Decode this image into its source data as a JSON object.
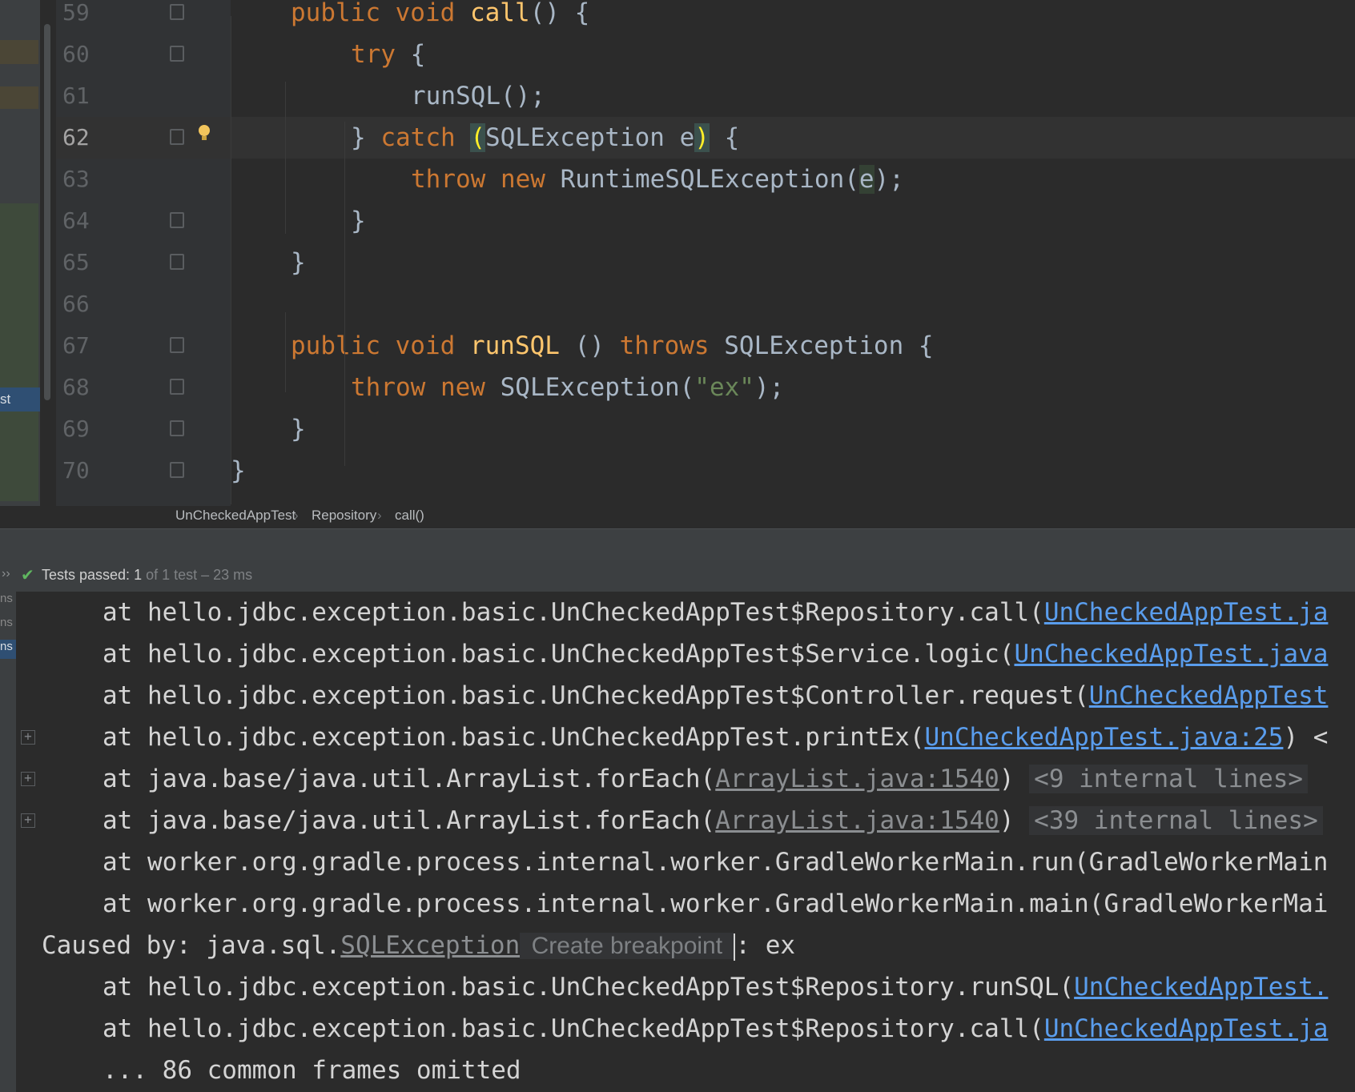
{
  "editor": {
    "side_tab_label": "st",
    "lines": [
      {
        "num": "59",
        "code": [
          {
            "t": "public void ",
            "c": "kw"
          },
          {
            "t": "call",
            "c": "fn"
          },
          {
            "t": "() {",
            "c": ""
          }
        ],
        "indent": 1
      },
      {
        "num": "60",
        "code": [
          {
            "t": "try ",
            "c": "kw"
          },
          {
            "t": "{",
            "c": ""
          }
        ],
        "indent": 2
      },
      {
        "num": "61",
        "code": [
          {
            "t": "runSQL();",
            "c": ""
          }
        ],
        "indent": 3
      },
      {
        "num": "62",
        "code": [
          {
            "t": "} ",
            "c": ""
          },
          {
            "t": "catch ",
            "c": "kw"
          },
          {
            "t": "(",
            "c": "paren-hl"
          },
          {
            "t": "SQLException e",
            "c": ""
          },
          {
            "t": ")",
            "c": "paren-hl"
          },
          {
            "t": " {",
            "c": ""
          }
        ],
        "indent": 2,
        "current": true
      },
      {
        "num": "63",
        "code": [
          {
            "t": "throw new ",
            "c": "kw"
          },
          {
            "t": "RuntimeSQLException(",
            "c": ""
          },
          {
            "t": "e",
            "c": "var-hl"
          },
          {
            "t": ");",
            "c": ""
          }
        ],
        "indent": 3
      },
      {
        "num": "64",
        "code": [
          {
            "t": "}",
            "c": ""
          }
        ],
        "indent": 2
      },
      {
        "num": "65",
        "code": [
          {
            "t": "}",
            "c": ""
          }
        ],
        "indent": 1
      },
      {
        "num": "66",
        "code": [],
        "indent": 0
      },
      {
        "num": "67",
        "code": [
          {
            "t": "public void ",
            "c": "kw"
          },
          {
            "t": "runSQL",
            "c": "fn"
          },
          {
            "t": " () ",
            "c": ""
          },
          {
            "t": "throws ",
            "c": "kw"
          },
          {
            "t": "SQLException {",
            "c": ""
          }
        ],
        "indent": 1
      },
      {
        "num": "68",
        "code": [
          {
            "t": "throw new ",
            "c": "kw"
          },
          {
            "t": "SQLException(",
            "c": ""
          },
          {
            "t": "\"ex\"",
            "c": "str"
          },
          {
            "t": ");",
            "c": ""
          }
        ],
        "indent": 2
      },
      {
        "num": "69",
        "code": [
          {
            "t": "}",
            "c": ""
          }
        ],
        "indent": 1
      },
      {
        "num": "70",
        "code": [
          {
            "t": "}",
            "c": ""
          }
        ],
        "indent": 0
      }
    ]
  },
  "breadcrumb": {
    "items": [
      "UnCheckedAppTest",
      "Repository",
      "call()"
    ],
    "separator": "›"
  },
  "run_status": {
    "label": "Tests passed:",
    "count": "1",
    "rest": "of 1 test – 23 ms"
  },
  "console_strip": [
    "ns",
    "ns",
    "ns"
  ],
  "console": {
    "lines": [
      {
        "indent": true,
        "segments": [
          {
            "t": "at hello.jdbc.exception.basic.UnCheckedAppTest$Repository.call(",
            "c": ""
          },
          {
            "t": "UnCheckedAppTest.ja",
            "c": "link"
          }
        ]
      },
      {
        "indent": true,
        "segments": [
          {
            "t": "at hello.jdbc.exception.basic.UnCheckedAppTest$Service.logic(",
            "c": ""
          },
          {
            "t": "UnCheckedAppTest.java",
            "c": "link"
          }
        ]
      },
      {
        "indent": true,
        "segments": [
          {
            "t": "at hello.jdbc.exception.basic.UnCheckedAppTest$Controller.request(",
            "c": ""
          },
          {
            "t": "UnCheckedAppTest",
            "c": "link"
          }
        ]
      },
      {
        "indent": true,
        "expand": true,
        "segments": [
          {
            "t": "at hello.jdbc.exception.basic.UnCheckedAppTest.printEx(",
            "c": ""
          },
          {
            "t": "UnCheckedAppTest.java:25",
            "c": "link"
          },
          {
            "t": ") <",
            "c": ""
          }
        ]
      },
      {
        "indent": true,
        "expand": true,
        "segments": [
          {
            "t": "at java.base/java.util.ArrayList.forEach(",
            "c": ""
          },
          {
            "t": "ArrayList.java:1540",
            "c": "link gray"
          },
          {
            "t": ") ",
            "c": ""
          },
          {
            "t": "<9 internal lines>",
            "c": "internal"
          }
        ]
      },
      {
        "indent": true,
        "expand": true,
        "segments": [
          {
            "t": "at java.base/java.util.ArrayList.forEach(",
            "c": ""
          },
          {
            "t": "ArrayList.java:1540",
            "c": "link gray"
          },
          {
            "t": ") ",
            "c": ""
          },
          {
            "t": "<39 internal lines>",
            "c": "internal"
          }
        ]
      },
      {
        "indent": true,
        "segments": [
          {
            "t": "at worker.org.gradle.process.internal.worker.GradleWorkerMain.run(GradleWorkerMain",
            "c": ""
          }
        ]
      },
      {
        "indent": true,
        "segments": [
          {
            "t": "at worker.org.gradle.process.internal.worker.GradleWorkerMain.main(GradleWorkerMai",
            "c": ""
          }
        ]
      },
      {
        "indent": false,
        "segments": [
          {
            "t": "Caused by: java.sql.",
            "c": ""
          },
          {
            "t": "SQLException",
            "c": "link gray"
          },
          {
            "t": " Create breakpoint ",
            "c": "hint"
          },
          {
            "t": "",
            "c": "caret"
          },
          {
            "t": ": ex",
            "c": ""
          }
        ]
      },
      {
        "indent": true,
        "segments": [
          {
            "t": "at hello.jdbc.exception.basic.UnCheckedAppTest$Repository.runSQL(",
            "c": ""
          },
          {
            "t": "UnCheckedAppTest.",
            "c": "link"
          }
        ]
      },
      {
        "indent": true,
        "segments": [
          {
            "t": "at hello.jdbc.exception.basic.UnCheckedAppTest$Repository.call(",
            "c": ""
          },
          {
            "t": "UnCheckedAppTest.ja",
            "c": "link"
          }
        ]
      },
      {
        "indent": true,
        "segments": [
          {
            "t": "... 86 common frames omitted",
            "c": ""
          }
        ]
      }
    ]
  }
}
